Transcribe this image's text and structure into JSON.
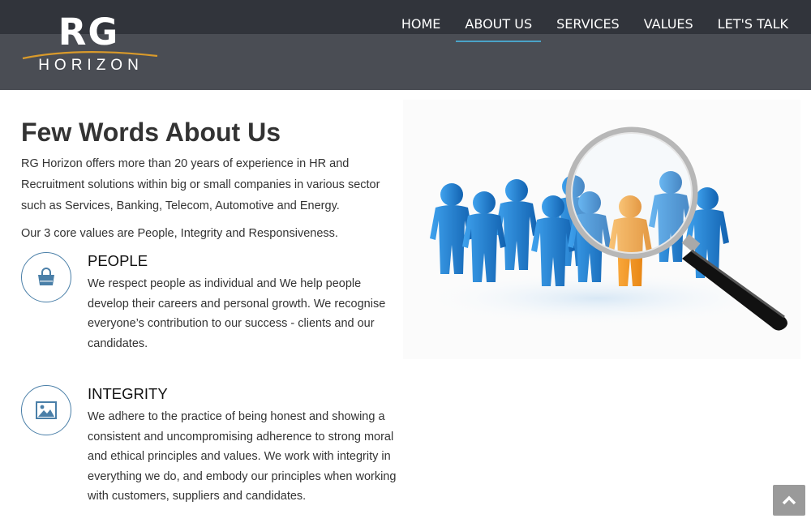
{
  "logo": {
    "primary": "RG",
    "secondary": "HORIZON",
    "icon": "rg-horizon-logo"
  },
  "nav": {
    "items": [
      {
        "label": "HOME",
        "active": false
      },
      {
        "label": "ABOUT US",
        "active": true
      },
      {
        "label": "SERVICES",
        "active": false
      },
      {
        "label": "VALUES",
        "active": false
      },
      {
        "label": "LET'S TALK",
        "active": false
      }
    ]
  },
  "about": {
    "heading": "Few Words About Us",
    "intro": "RG Horizon offers more than 20 years of experience in HR and Recruitment solutions within big or small companies in various sector such as Services, Banking, Telecom, Automotive and Energy.",
    "core_values": "Our 3 core values are People, Integrity and Responsiveness."
  },
  "values": [
    {
      "title": "PEOPLE",
      "icon": "shopping-bag-icon",
      "text": "We respect people as individual and We help people develop their careers and personal growth. We recognise everyone’s contribution to our success - clients and our candidates."
    },
    {
      "title": "INTEGRITY",
      "icon": "image-icon",
      "text": "We adhere to the practice of being honest and showing a consistent and uncompromising adherence to strong moral and ethical principles and values. We work with integrity in everything we do, and embody our principles when working with customers, suppliers and candidates."
    }
  ],
  "illustration": {
    "subject": "magnifying glass over a crowd of figures",
    "icon": "magnifier-crowd-illustration"
  },
  "back_to_top": {
    "icon": "chevron-up-icon"
  },
  "colors": {
    "header_top": "#31343b",
    "header_bottom": "#4a4d54",
    "accent": "#4aa3c8",
    "icon_blue": "#4a7fa8",
    "figure_blue": "#1f86d8",
    "figure_orange": "#f3961a",
    "text": "#333333"
  }
}
